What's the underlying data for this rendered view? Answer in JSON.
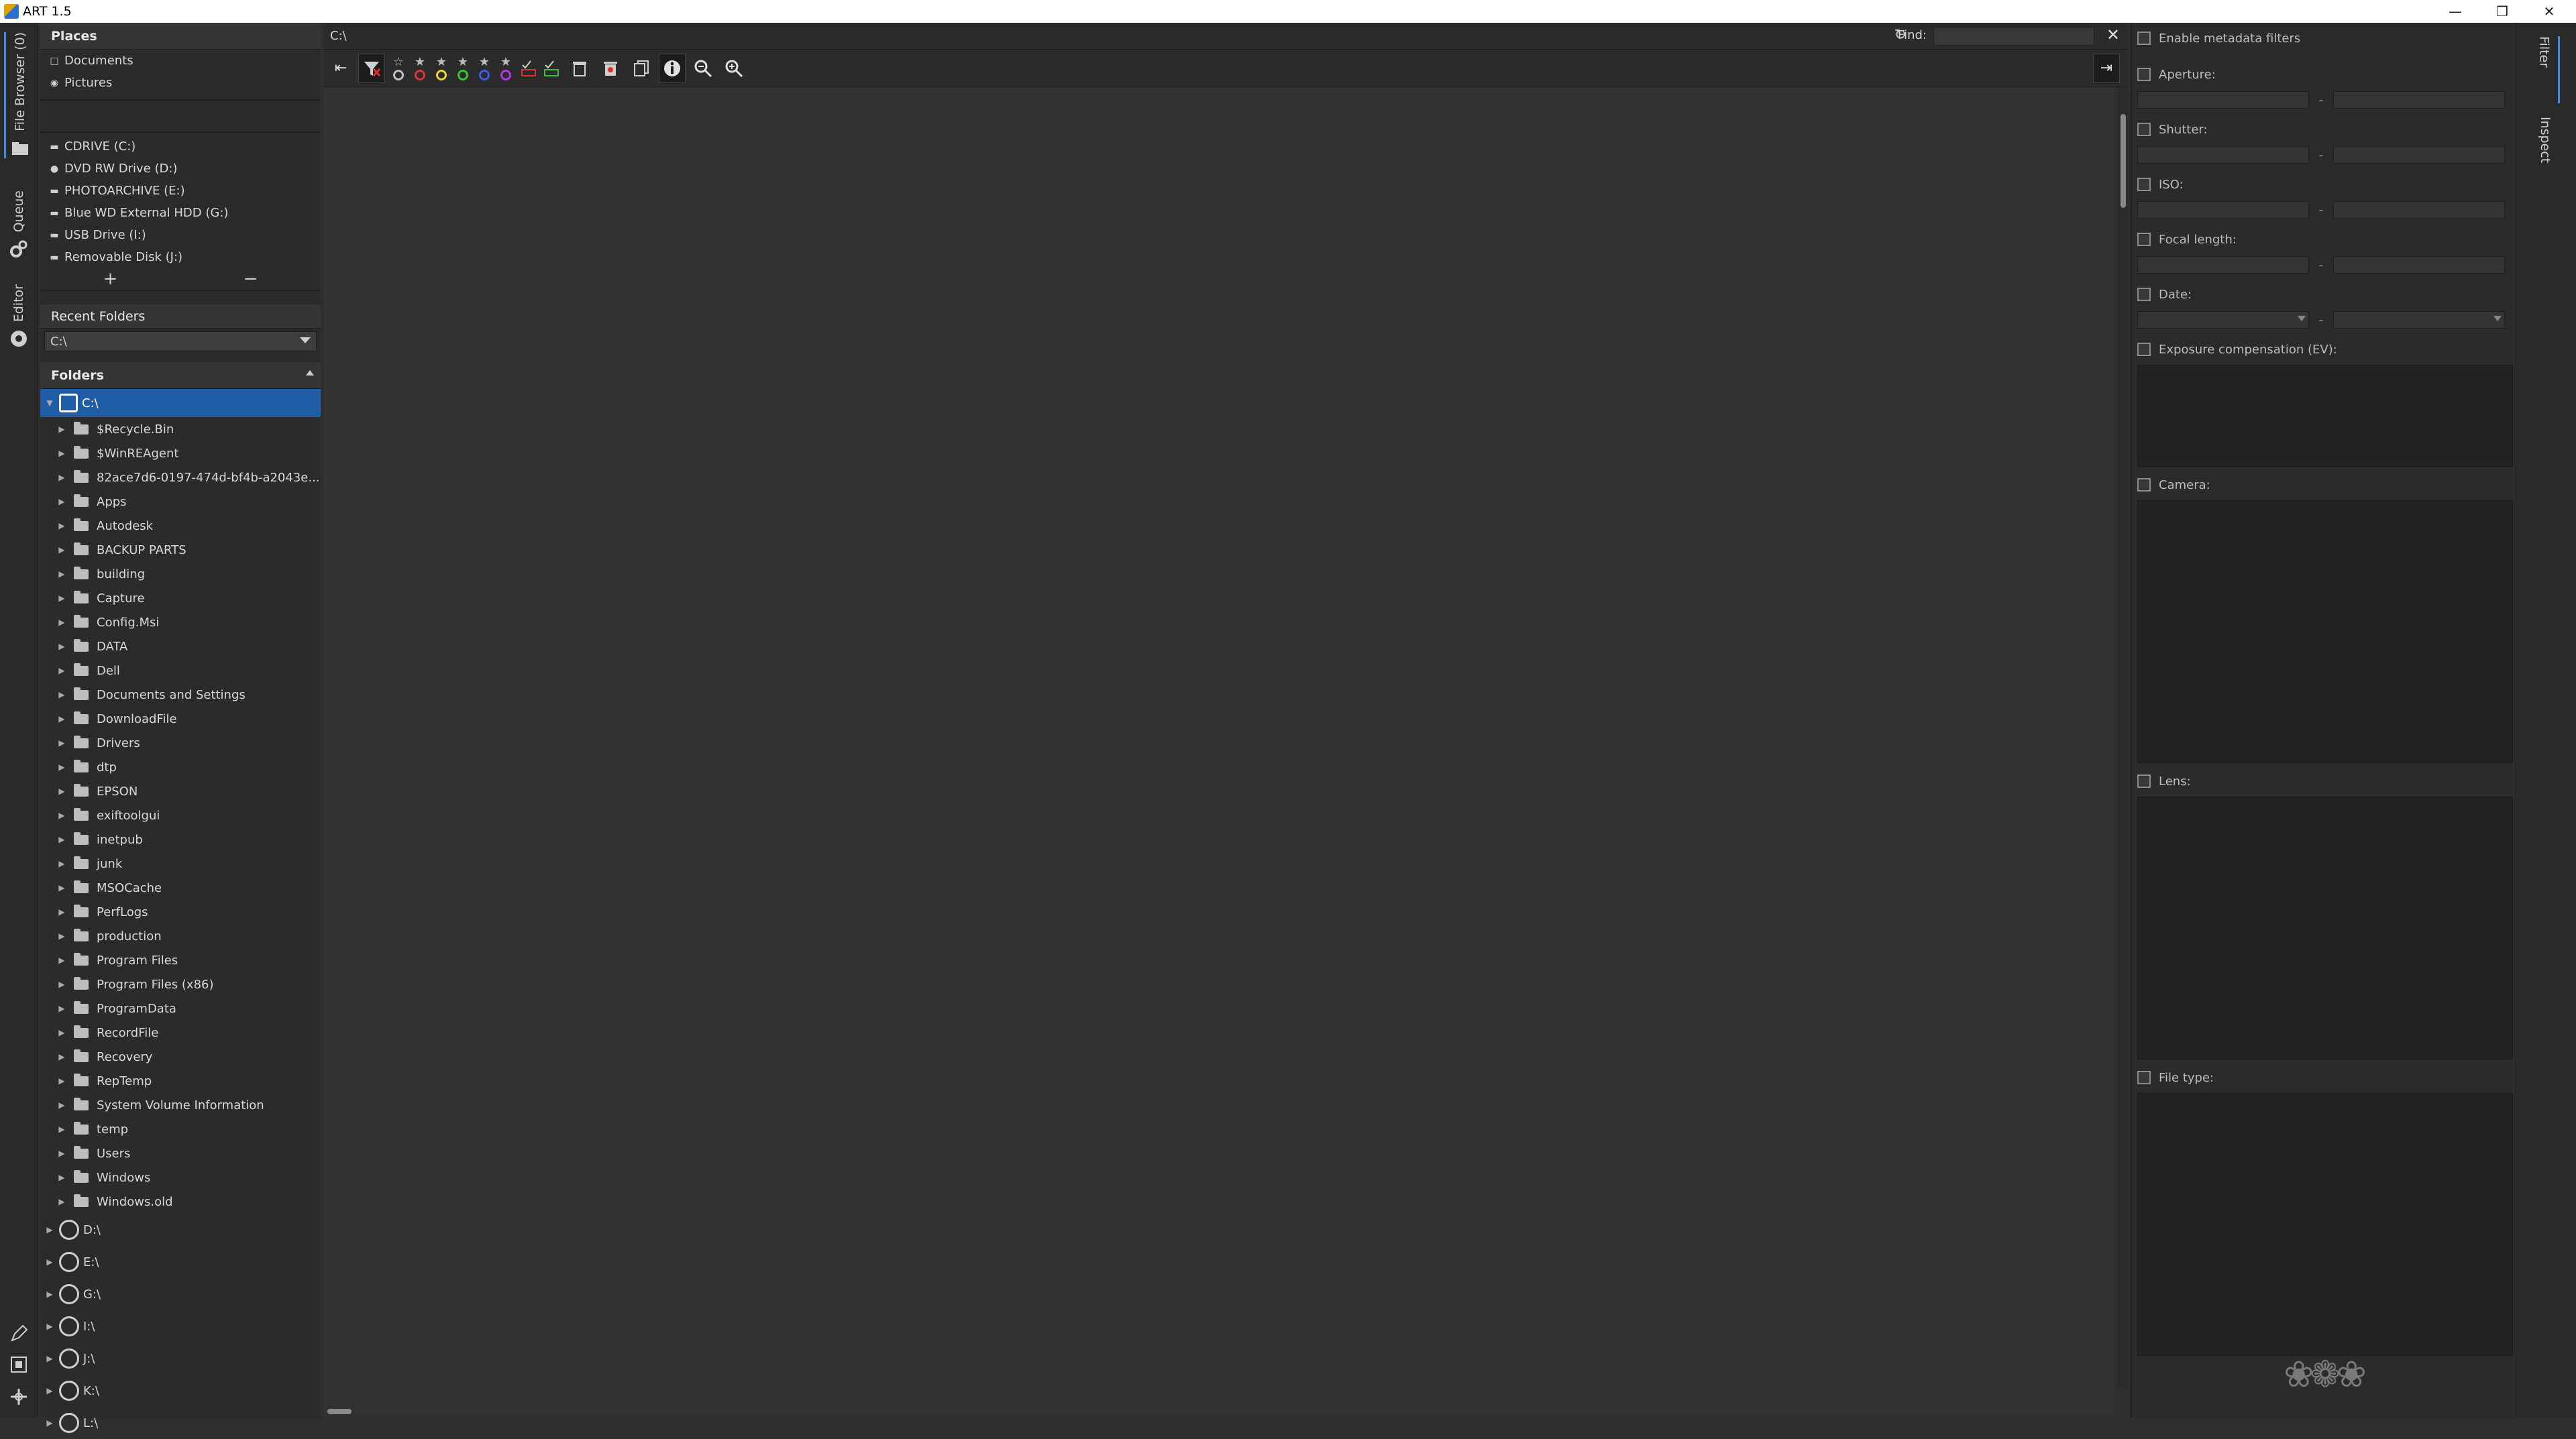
{
  "window": {
    "title": "ART 1.5"
  },
  "left_tabs": {
    "file_browser": "File Browser (0)",
    "queue": "Queue",
    "editor": "Editor"
  },
  "places": {
    "header": "Places",
    "items": [
      {
        "label": "Documents"
      },
      {
        "label": "Pictures"
      }
    ],
    "drives": [
      {
        "label": "CDRIVE (C:)"
      },
      {
        "label": "DVD RW Drive (D:)"
      },
      {
        "label": "PHOTOARCHIVE (E:)"
      },
      {
        "label": "Blue WD External HDD (G:)"
      },
      {
        "label": "USB Drive (I:)"
      },
      {
        "label": "Removable Disk (J:)"
      }
    ],
    "add": "+",
    "remove": "−"
  },
  "recent": {
    "header": "Recent Folders",
    "value": "C:\\"
  },
  "folders": {
    "header": "Folders",
    "root": "C:\\",
    "children": [
      "$Recycle.Bin",
      "$WinREAgent",
      "82ace7d6-0197-474d-bf4b-a2043e...",
      "Apps",
      "Autodesk",
      "BACKUP PARTS",
      "building",
      "Capture",
      "Config.Msi",
      "DATA",
      "Dell",
      "Documents and Settings",
      "DownloadFile",
      "Drivers",
      "dtp",
      "EPSON",
      "exiftoolgui",
      "inetpub",
      "junk",
      "MSOCache",
      "PerfLogs",
      "production",
      "Program Files",
      "Program Files (x86)",
      "ProgramData",
      "RecordFile",
      "Recovery",
      "RepTemp",
      "System Volume Information",
      "temp",
      "Users",
      "Windows",
      "Windows.old"
    ],
    "other_drives": [
      "D:\\",
      "E:\\",
      "G:\\",
      "I:\\",
      "J:\\",
      "K:\\",
      "L:\\"
    ]
  },
  "browser": {
    "path": "C:\\",
    "find_label": "Find:",
    "find_value": ""
  },
  "filters": {
    "enable": "Enable metadata filters",
    "aperture": "Aperture:",
    "shutter": "Shutter:",
    "iso": "ISO:",
    "focal": "Focal length:",
    "date": "Date:",
    "exposure": "Exposure compensation (EV):",
    "camera": "Camera:",
    "lens": "Lens:",
    "filetype": "File type:",
    "dash": "-"
  },
  "right_tabs": {
    "filter": "Filter",
    "inspect": "Inspect"
  },
  "colors": {
    "accent": "#3a8ee6",
    "selection": "#1f5ca6"
  }
}
